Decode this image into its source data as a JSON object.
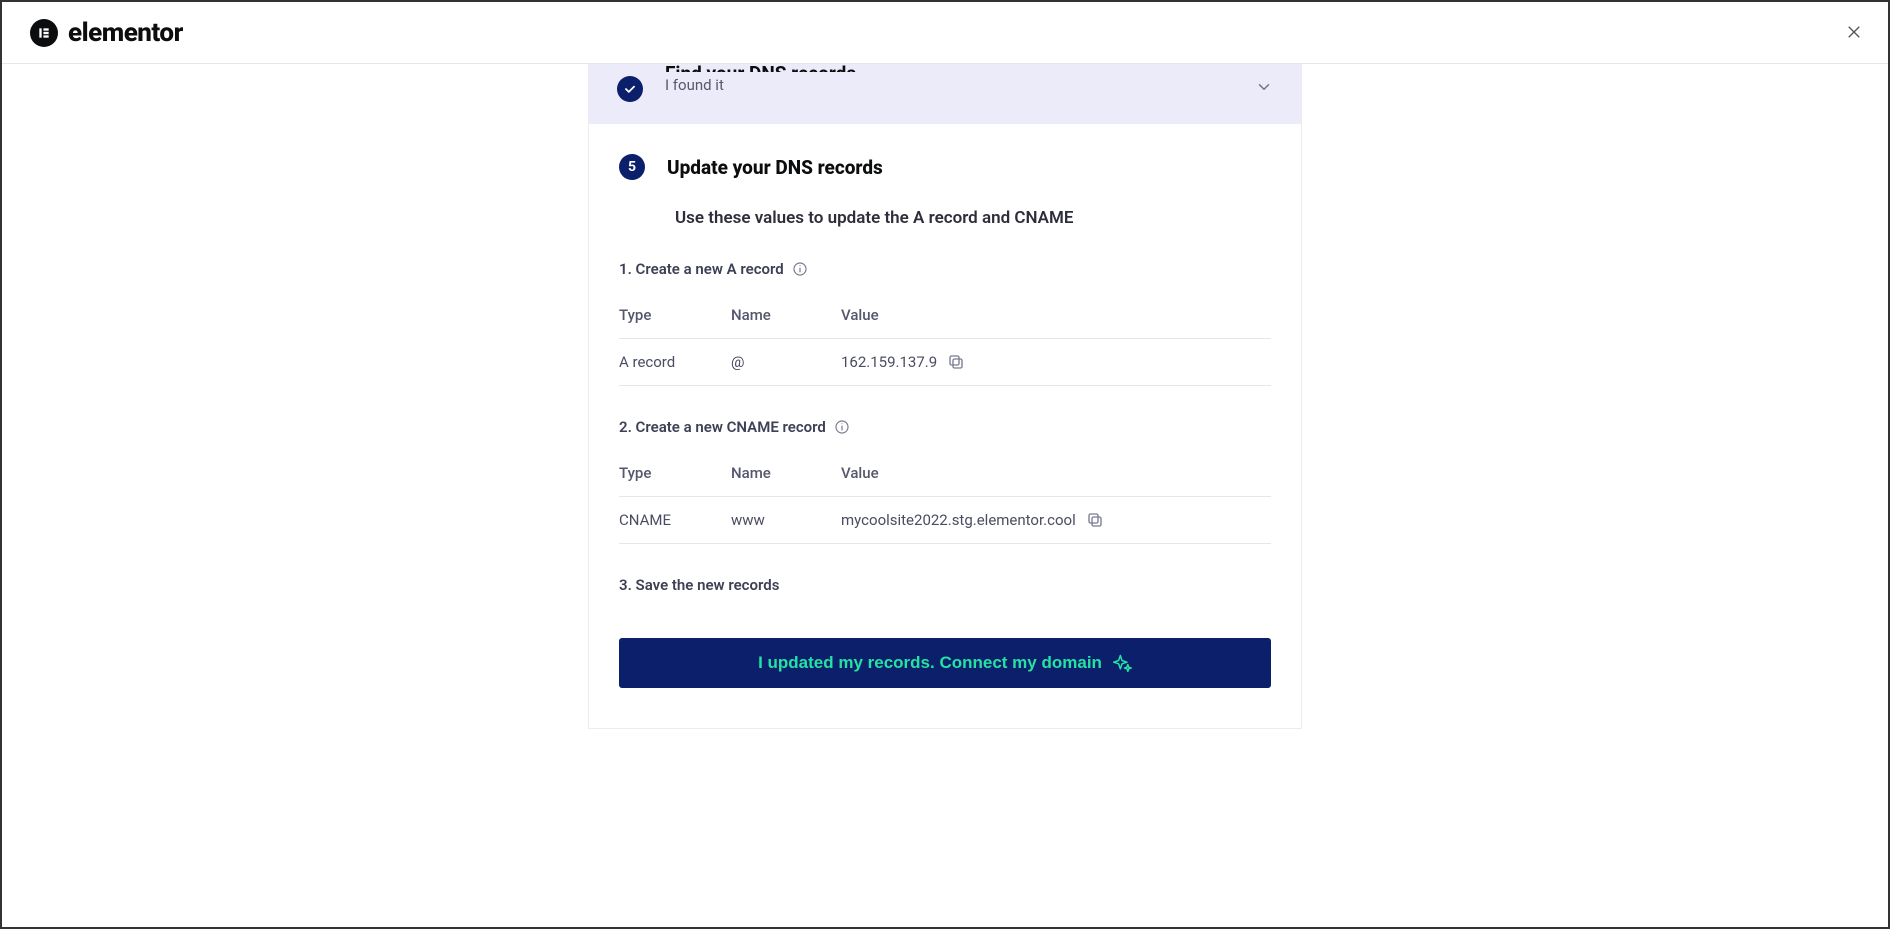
{
  "brand": {
    "name": "elementor"
  },
  "collapsed_step": {
    "title": "Find your DNS records",
    "subtitle": "I found it"
  },
  "current_step": {
    "number": "5",
    "title": "Update your DNS records",
    "intro": "Use these values to update the A record and CNAME",
    "sub1": "1. Create a new A record",
    "sub2": "2. Create a new CNAME record",
    "sub3": "3. Save the new records"
  },
  "table": {
    "headers": {
      "type": "Type",
      "name": "Name",
      "value": "Value"
    },
    "a_record": {
      "type": "A record",
      "name": "@",
      "value": "162.159.137.9"
    },
    "cname_record": {
      "type": "CNAME",
      "name": "www",
      "value": "mycoolsite2022.stg.elementor.cool"
    }
  },
  "cta": {
    "label": "I updated my records. Connect my domain"
  }
}
